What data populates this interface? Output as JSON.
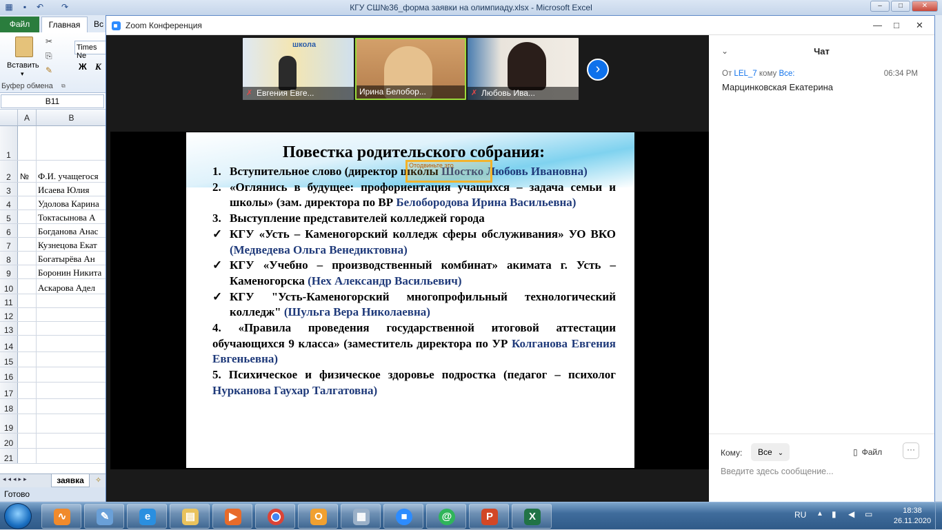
{
  "excel": {
    "title": "КГУ СШ№36_форма заявки на олимпиаду.xlsx  -  Microsoft Excel",
    "tab_file": "Файл",
    "tab_home": "Главная",
    "tab_insert": "Вс",
    "paste_label": "Вставить",
    "clipboard_label": "Буфер обмена",
    "font_name": "Times Ne",
    "bold": "Ж",
    "italic": "К",
    "name_box": "B11",
    "col_a": "A",
    "col_b": "B",
    "rows": [
      {
        "n": "1",
        "a": "",
        "b": ""
      },
      {
        "n": "2",
        "a": "№",
        "b": "Ф.И. учащегося"
      },
      {
        "n": "3",
        "a": "",
        "b": "Исаева Юлия"
      },
      {
        "n": "4",
        "a": "",
        "b": "Удолова Карина"
      },
      {
        "n": "5",
        "a": "",
        "b": "Токтасынова А"
      },
      {
        "n": "6",
        "a": "",
        "b": "Богданова Анас"
      },
      {
        "n": "7",
        "a": "",
        "b": "Кузнецова Екат"
      },
      {
        "n": "8",
        "a": "",
        "b": "Богатырёва Ан"
      },
      {
        "n": "9",
        "a": "",
        "b": "Боронин Никита"
      },
      {
        "n": "10",
        "a": "",
        "b": "Аскарова Адел"
      },
      {
        "n": "11",
        "a": "",
        "b": ""
      },
      {
        "n": "12",
        "a": "",
        "b": ""
      },
      {
        "n": "13",
        "a": "",
        "b": ""
      },
      {
        "n": "14",
        "a": "",
        "b": ""
      },
      {
        "n": "15",
        "a": "",
        "b": ""
      },
      {
        "n": "16",
        "a": "",
        "b": ""
      },
      {
        "n": "17",
        "a": "",
        "b": ""
      },
      {
        "n": "18",
        "a": "",
        "b": ""
      },
      {
        "n": "19",
        "a": "",
        "b": ""
      },
      {
        "n": "20",
        "a": "",
        "b": ""
      },
      {
        "n": "21",
        "a": "",
        "b": ""
      }
    ],
    "sheet_tab": "заявка",
    "status": "Готово"
  },
  "zoom": {
    "title": "Zoom Конференция",
    "participants": [
      {
        "name": "Евгения Евге...",
        "muted": true
      },
      {
        "name": "Ирина Белобор...",
        "muted": false
      },
      {
        "name": "Любовь Ива...",
        "muted": true
      }
    ],
    "slide": {
      "title": "Повестка родительского собрания:",
      "highlight_text": "Отодвиньте это",
      "items": [
        {
          "marker": "1.",
          "text": "Вступительное слово (директор школы ",
          "name": "Шостко Любовь Ивановна)"
        },
        {
          "marker": "2.",
          "text": "«Оглянись в будущее: профориентация учащихся – задача семьи и школы» (зам. директора по ВР ",
          "name": "Белобородова Ирина Васильевна)"
        },
        {
          "marker": "3.",
          "text": "Выступление представителей колледжей города",
          "name": ""
        },
        {
          "marker": "✓",
          "text": "КГУ «Усть – Каменогорский колледж сферы обслуживания» УО ВКО ",
          "name": "(Медведева Ольга Венедиктовна)"
        },
        {
          "marker": "✓",
          "text": "КГУ «Учебно – производственный комбинат» акимата г. Усть – Каменогорска ",
          "name": "(Нех Александр Васильевич)"
        },
        {
          "marker": "✓",
          "text": "КГУ \"Усть-Каменогорский многопрофильный технологический колледж\" ",
          "name": "(Шульга Вера Николаевна)"
        }
      ],
      "para4_text": "4. «Правила проведения государственной итоговой аттестации обучающихся 9 класса» (заместитель директора по УР ",
      "para4_name": "Колганова Евгения Евгеньевна)",
      "para5_text": "5. Психическое и физическое здоровье подростка (педагог – психолог ",
      "para5_name": "Нурканова Гаухар Талгатовна)"
    },
    "chat": {
      "title": "Чат",
      "from_prefix": "От",
      "from_name": "LEL_7",
      "to_word": "кому",
      "to_target": "Все:",
      "time": "06:34 PM",
      "message": "Марцинковская Екатерина",
      "to_label": "Кому:",
      "to_value": "Все",
      "file_label": "Файл",
      "more": "···",
      "input_placeholder": "Введите здесь сообщение..."
    }
  },
  "taskbar": {
    "lang": "RU",
    "time": "18:38",
    "date": "26.11.2020",
    "apps": [
      "pulse",
      "paint",
      "ie",
      "explorer",
      "media",
      "chrome",
      "outlook",
      "calculator",
      "zoom",
      "chat",
      "powerpoint",
      "excel"
    ]
  }
}
